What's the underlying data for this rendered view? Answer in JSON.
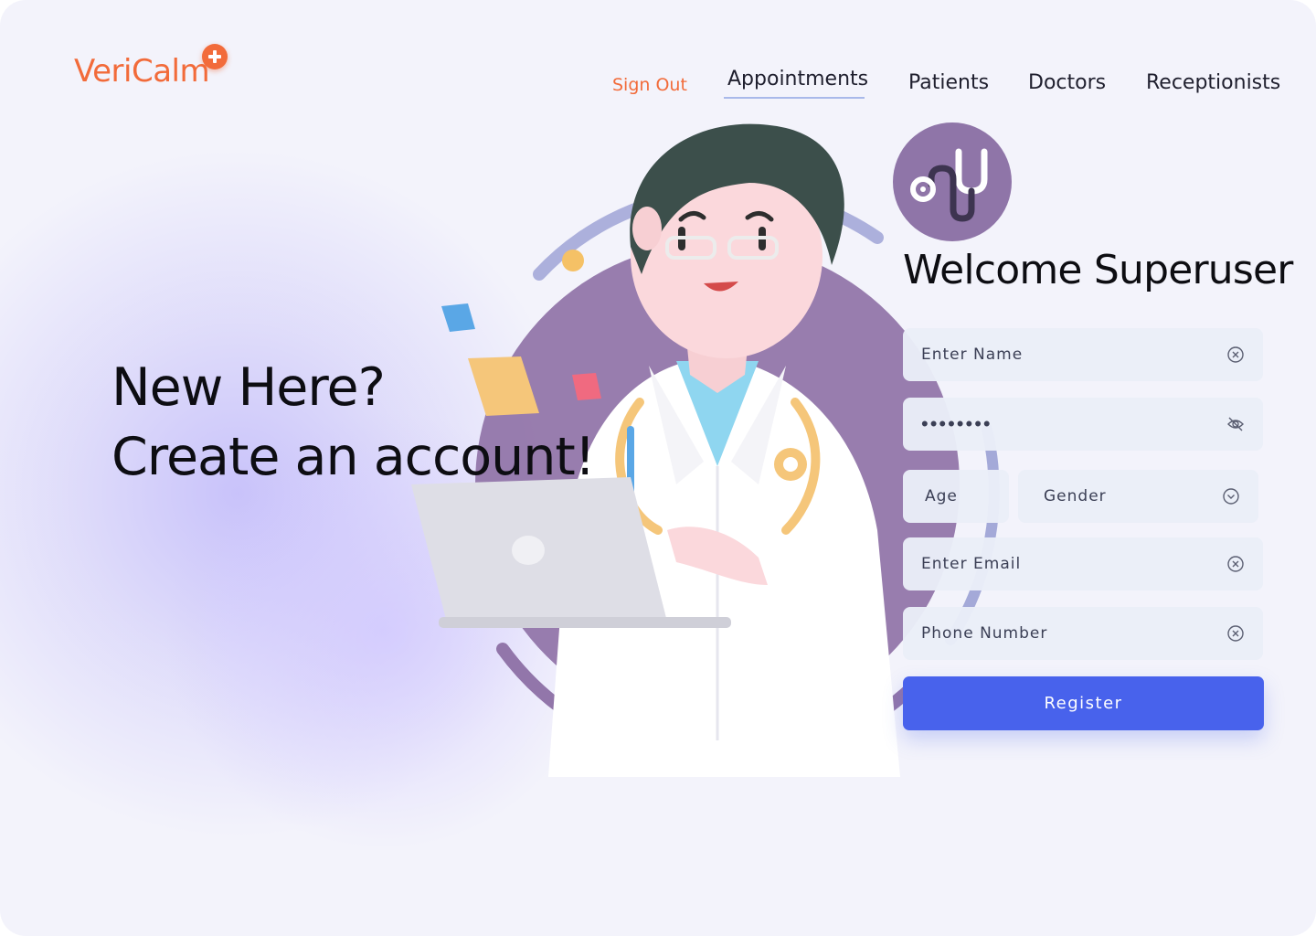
{
  "brand": {
    "name": "VeriCalm",
    "accent": "#f26b3a"
  },
  "nav": {
    "sign_out": "Sign Out",
    "items": [
      {
        "label": "Appointments",
        "active": true
      },
      {
        "label": "Patients"
      },
      {
        "label": "Doctors"
      },
      {
        "label": "Receptionists"
      }
    ]
  },
  "hero": {
    "line1": "New Here?",
    "line2": "Create an account!"
  },
  "form": {
    "welcome": "Welcome Superuser",
    "avatar_icon": "stethoscope-icon",
    "name_placeholder": "Enter Name",
    "password_value": "••••••••",
    "age_placeholder": "Age",
    "gender_placeholder": "Gender",
    "email_placeholder": "Enter Email",
    "phone_placeholder": "Phone Number",
    "register_label": "Register",
    "button_color": "#4862ec"
  }
}
